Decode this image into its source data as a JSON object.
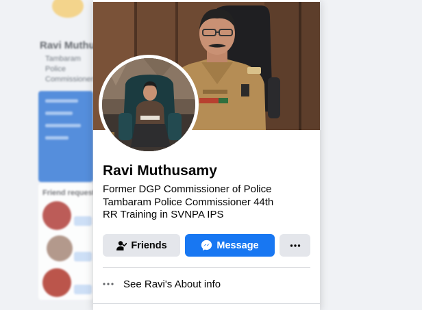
{
  "background": {
    "heading": "Ravi Muthus",
    "lines": [
      "Tambaram",
      "Police",
      "Commissioner"
    ],
    "section_title": "Friend requests"
  },
  "profile_card": {
    "name": "Ravi Muthusamy",
    "bio_lines": [
      "Former DGP Commissioner of Police",
      "Tambaram Police Commissioner 44th",
      "RR Training in SVNPA IPS"
    ],
    "buttons": {
      "friends": "Friends",
      "message": "Message",
      "more_icon": "more-horizontal-icon"
    },
    "about_label": "See Ravi's About info"
  },
  "colors": {
    "primary_blue": "#1877f2",
    "button_grey": "#e4e6eb",
    "text": "#050505",
    "page_bg": "#f0f2f5"
  }
}
